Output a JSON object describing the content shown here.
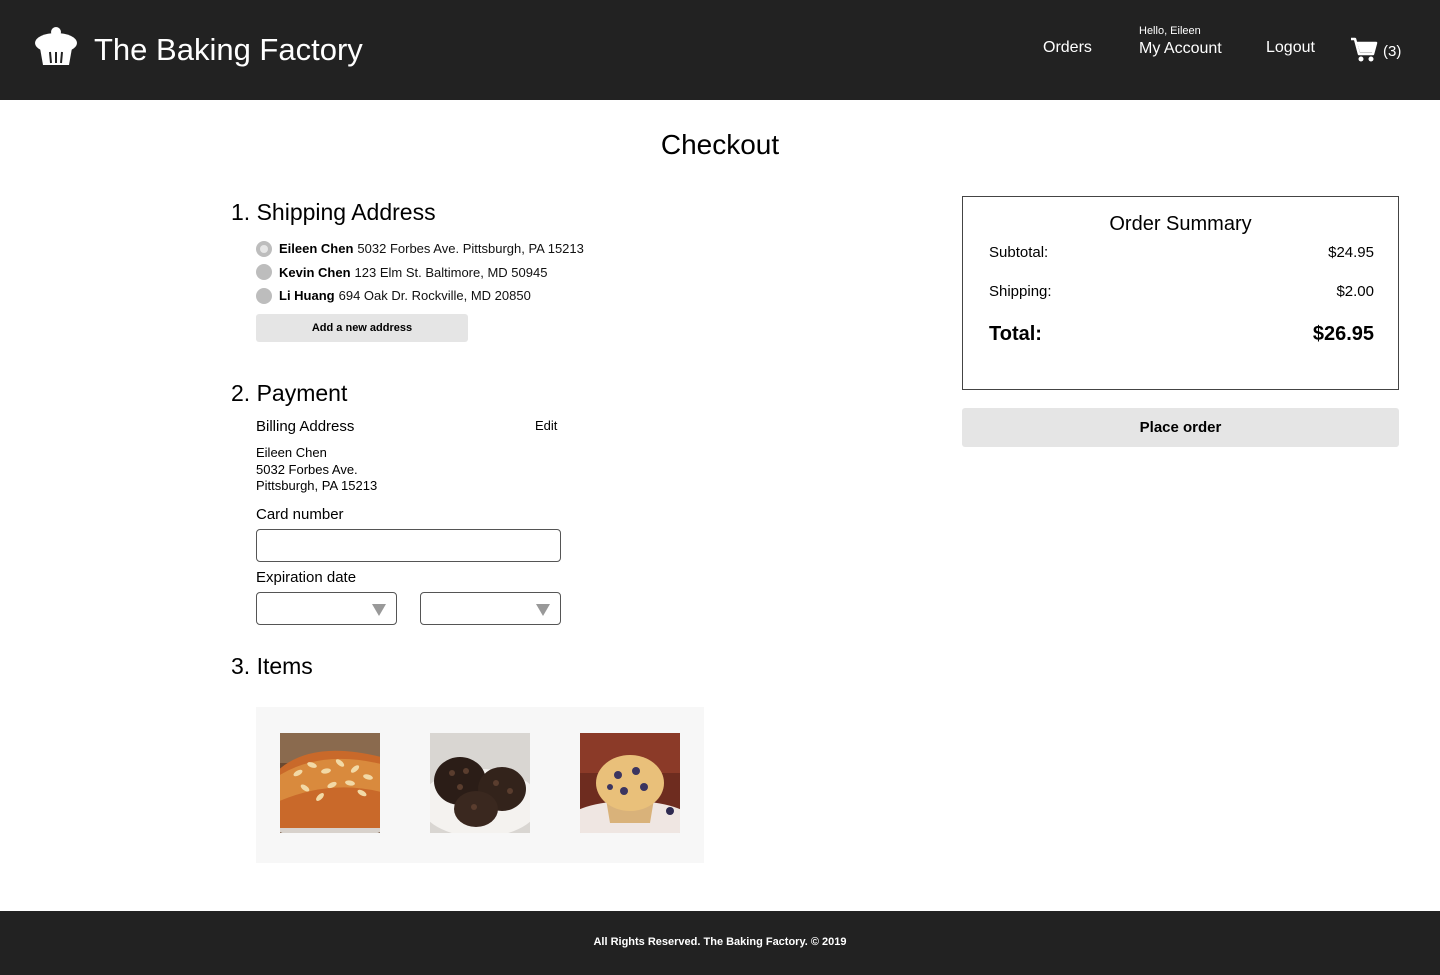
{
  "header": {
    "brand": "The Baking Factory",
    "nav": {
      "orders": "Orders",
      "greeting": "Hello, Eileen",
      "account": "My Account",
      "logout": "Logout",
      "cart_count": "(3)"
    }
  },
  "page": {
    "title": "Checkout"
  },
  "shipping": {
    "heading": "1. Shipping Address",
    "addresses": [
      {
        "name": "Eileen Chen",
        "address": "5032 Forbes Ave. Pittsburgh, PA 15213",
        "selected": true
      },
      {
        "name": "Kevin Chen",
        "address": "123 Elm St. Baltimore, MD 50945",
        "selected": false
      },
      {
        "name": "Li Huang",
        "address": "694 Oak Dr. Rockville, MD 20850",
        "selected": false
      }
    ],
    "add_button": "Add a new address"
  },
  "payment": {
    "heading": "2. Payment",
    "billing_label": "Billing Address",
    "edit_label": "Edit",
    "billing": {
      "name": "Eileen Chen",
      "street": "5032 Forbes Ave.",
      "city": "Pittsburgh, PA 15213"
    },
    "card_label": "Card number",
    "card_value": "",
    "expiration_label": "Expiration date",
    "exp_month": "",
    "exp_year": ""
  },
  "items": {
    "heading": "3. Items",
    "images": [
      "almond-pastry-image",
      "chocolate-muffins-image",
      "blueberry-muffin-image"
    ]
  },
  "summary": {
    "title": "Order Summary",
    "subtotal_label": "Subtotal:",
    "subtotal": "$24.95",
    "shipping_label": "Shipping:",
    "shipping": "$2.00",
    "total_label": "Total:",
    "total": "$26.95"
  },
  "place_order": "Place order",
  "footer": {
    "text": "All Rights Reserved. The Baking Factory. © 2019"
  },
  "colors": {
    "header_bg": "#222222",
    "button_bg": "#e5e5e5",
    "radio": "#bdbdbd",
    "items_bg": "#f7f7f7"
  }
}
